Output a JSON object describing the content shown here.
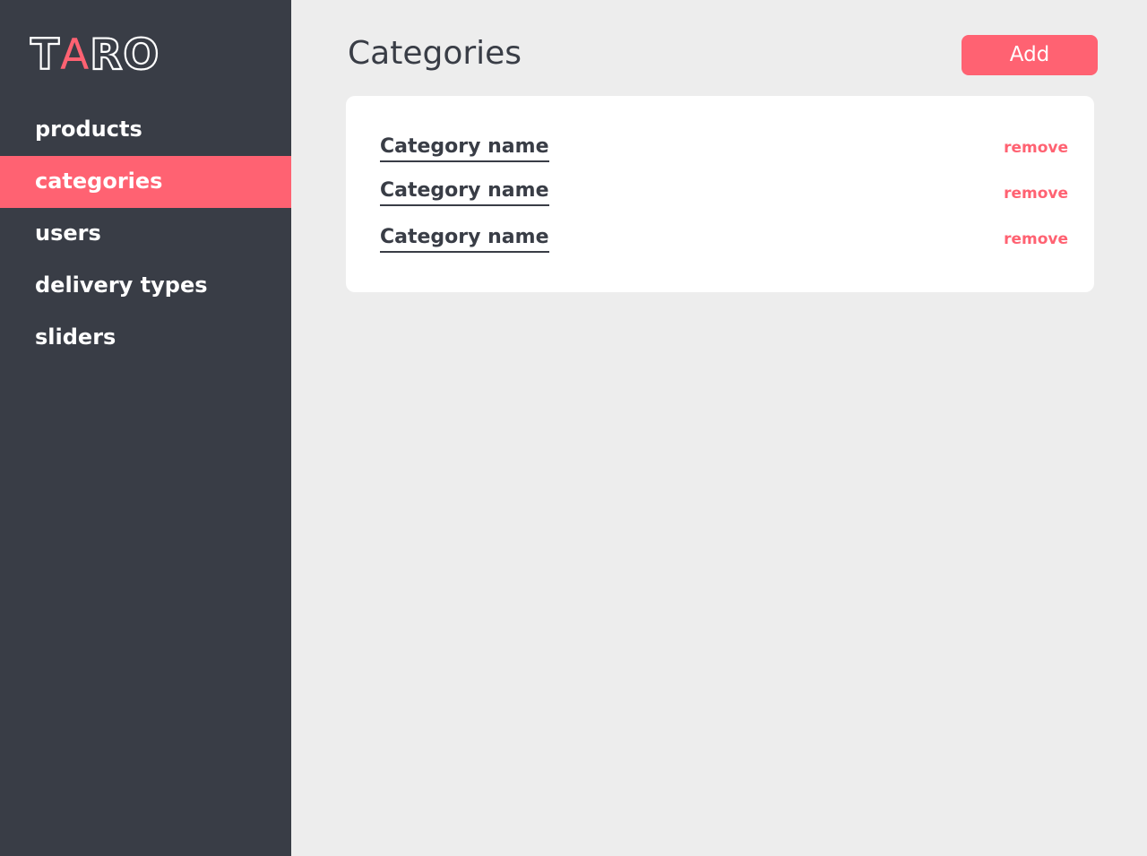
{
  "brand": {
    "logo_prefix": "T",
    "logo_accent": "A",
    "logo_suffix": "RO",
    "accent_color": "#ff6272",
    "sidebar_color": "#393d46"
  },
  "sidebar": {
    "items": [
      {
        "label": "products",
        "active": false
      },
      {
        "label": "categories",
        "active": true
      },
      {
        "label": "users",
        "active": false
      },
      {
        "label": "delivery types",
        "active": false
      },
      {
        "label": "sliders",
        "active": false
      }
    ]
  },
  "main": {
    "title": "Categories",
    "add_label": "Add",
    "categories": [
      {
        "name": "Category name",
        "remove_label": "remove"
      },
      {
        "name": "Category name",
        "remove_label": "remove"
      },
      {
        "name": "Category name",
        "remove_label": "remove"
      }
    ]
  }
}
